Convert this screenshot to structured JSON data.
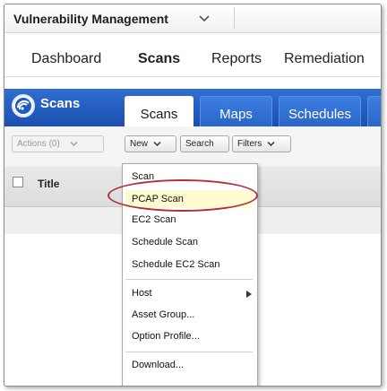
{
  "app": {
    "title": "Vulnerability Management"
  },
  "nav": {
    "items": [
      {
        "label": "Dashboard",
        "active": false
      },
      {
        "label": "Scans",
        "active": true
      },
      {
        "label": "Reports",
        "active": false
      },
      {
        "label": "Remediation",
        "active": false
      }
    ]
  },
  "module": {
    "title": "Scans",
    "tabs": [
      {
        "label": "Scans",
        "active": true
      },
      {
        "label": "Maps",
        "active": false
      },
      {
        "label": "Schedules",
        "active": false
      }
    ]
  },
  "toolbar": {
    "actions_label": "Actions (0)",
    "new_label": "New",
    "search_label": "Search",
    "filters_label": "Filters"
  },
  "table": {
    "columns": [
      "Title"
    ]
  },
  "new_menu": {
    "items": [
      {
        "label": "Scan",
        "highlighted": false
      },
      {
        "label": "PCAP Scan",
        "highlighted": true
      },
      {
        "label": "EC2 Scan",
        "highlighted": false
      },
      {
        "label": "Schedule Scan",
        "highlighted": false
      },
      {
        "label": "Schedule EC2 Scan",
        "highlighted": false
      },
      {
        "label": "Host",
        "highlighted": false,
        "has_submenu": true
      },
      {
        "label": "Asset Group...",
        "highlighted": false
      },
      {
        "label": "Option Profile...",
        "highlighted": false
      },
      {
        "label": "Download...",
        "highlighted": false
      }
    ]
  },
  "colors": {
    "module_bar": "#1f5bc1",
    "highlight": "#fffbd0",
    "annotation_ring": "#b0303c"
  }
}
